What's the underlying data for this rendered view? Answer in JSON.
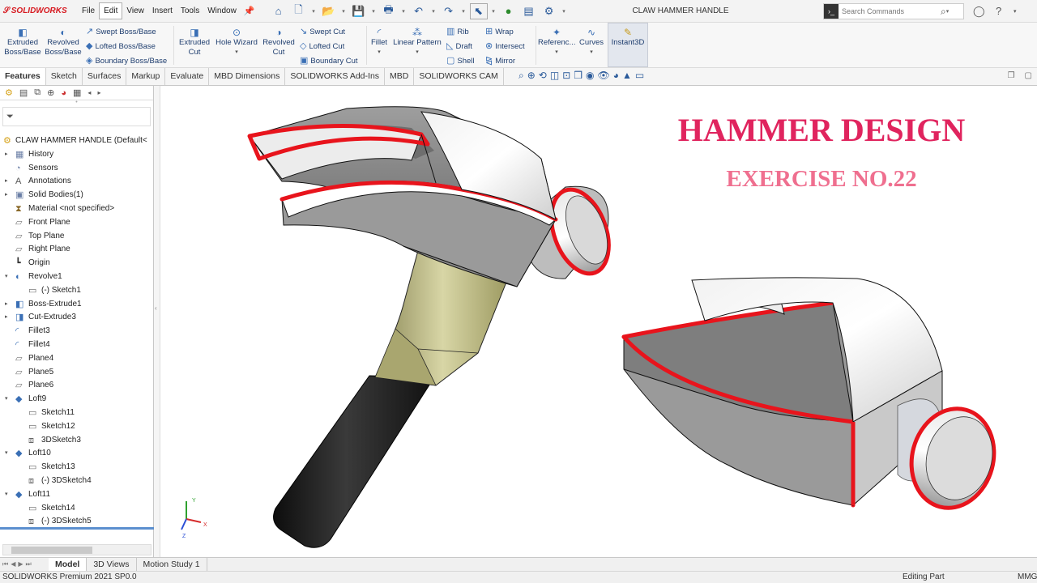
{
  "app": {
    "brand": "SOLIDWORKS",
    "document_title": "CLAW HAMMER HANDLE"
  },
  "menu": {
    "items": [
      "File",
      "Edit",
      "View",
      "Insert",
      "Tools",
      "Window"
    ],
    "active_item": "Edit"
  },
  "search": {
    "placeholder": "Search Commands"
  },
  "ribbon": {
    "extruded_boss": "Extruded Boss/Base",
    "revolved_boss": "Revolved Boss/Base",
    "swept_boss": "Swept Boss/Base",
    "lofted_boss": "Lofted Boss/Base",
    "boundary_boss": "Boundary Boss/Base",
    "extruded_cut": "Extruded Cut",
    "hole_wizard": "Hole Wizard",
    "revolved_cut": "Revolved Cut",
    "swept_cut": "Swept Cut",
    "lofted_cut": "Lofted Cut",
    "boundary_cut": "Boundary Cut",
    "fillet": "Fillet",
    "linear_pattern": "Linear Pattern",
    "rib": "Rib",
    "draft": "Draft",
    "shell": "Shell",
    "wrap": "Wrap",
    "intersect": "Intersect",
    "mirror": "Mirror",
    "reference": "Referenc...",
    "curves": "Curves",
    "instant3d": "Instant3D"
  },
  "command_tabs": [
    "Features",
    "Sketch",
    "Surfaces",
    "Markup",
    "Evaluate",
    "MBD Dimensions",
    "SOLIDWORKS Add-Ins",
    "MBD",
    "SOLIDWORKS CAM"
  ],
  "feature_tree": {
    "root": "CLAW HAMMER HANDLE  (Default<",
    "nodes": [
      {
        "label": "History",
        "level": 0,
        "expandable": true,
        "icon": "folder-icon"
      },
      {
        "label": "Sensors",
        "level": 0,
        "expandable": false,
        "icon": "sensor-icon"
      },
      {
        "label": "Annotations",
        "level": 0,
        "expandable": true,
        "icon": "annotation-icon"
      },
      {
        "label": "Solid Bodies(1)",
        "level": 0,
        "expandable": true,
        "icon": "solid-body-icon"
      },
      {
        "label": "Material <not specified>",
        "level": 0,
        "expandable": false,
        "icon": "material-icon"
      },
      {
        "label": "Front Plane",
        "level": 0,
        "expandable": false,
        "icon": "plane-icon"
      },
      {
        "label": "Top Plane",
        "level": 0,
        "expandable": false,
        "icon": "plane-icon"
      },
      {
        "label": "Right Plane",
        "level": 0,
        "expandable": false,
        "icon": "plane-icon"
      },
      {
        "label": "Origin",
        "level": 0,
        "expandable": false,
        "icon": "origin-icon"
      },
      {
        "label": "Revolve1",
        "level": 0,
        "expandable": true,
        "expanded": true,
        "icon": "revolve-icon"
      },
      {
        "label": "(-) Sketch1",
        "level": 1,
        "expandable": false,
        "icon": "sketch-icon"
      },
      {
        "label": "Boss-Extrude1",
        "level": 0,
        "expandable": true,
        "icon": "extrude-icon"
      },
      {
        "label": "Cut-Extrude3",
        "level": 0,
        "expandable": true,
        "icon": "cut-extrude-icon"
      },
      {
        "label": "Fillet3",
        "level": 0,
        "expandable": false,
        "icon": "fillet-icon"
      },
      {
        "label": "Fillet4",
        "level": 0,
        "expandable": false,
        "icon": "fillet-icon"
      },
      {
        "label": "Plane4",
        "level": 0,
        "expandable": false,
        "icon": "plane-icon"
      },
      {
        "label": "Plane5",
        "level": 0,
        "expandable": false,
        "icon": "plane-icon"
      },
      {
        "label": "Plane6",
        "level": 0,
        "expandable": false,
        "icon": "plane-icon"
      },
      {
        "label": "Loft9",
        "level": 0,
        "expandable": true,
        "expanded": true,
        "icon": "loft-icon"
      },
      {
        "label": "Sketch11",
        "level": 1,
        "expandable": false,
        "icon": "sketch-icon"
      },
      {
        "label": "Sketch12",
        "level": 1,
        "expandable": false,
        "icon": "sketch-icon"
      },
      {
        "label": "3DSketch3",
        "level": 1,
        "expandable": false,
        "icon": "3dsketch-icon"
      },
      {
        "label": "Loft10",
        "level": 0,
        "expandable": true,
        "expanded": true,
        "icon": "loft-icon"
      },
      {
        "label": "Sketch13",
        "level": 1,
        "expandable": false,
        "icon": "sketch-icon"
      },
      {
        "label": "(-) 3DSketch4",
        "level": 1,
        "expandable": false,
        "icon": "3dsketch-icon"
      },
      {
        "label": "Loft11",
        "level": 0,
        "expandable": true,
        "expanded": true,
        "icon": "loft-icon"
      },
      {
        "label": "Sketch14",
        "level": 1,
        "expandable": false,
        "icon": "sketch-icon"
      },
      {
        "label": "(-) 3DSketch5",
        "level": 1,
        "expandable": false,
        "icon": "3dsketch-icon"
      }
    ]
  },
  "viewport": {
    "title": "HAMMER DESIGN",
    "subtitle": "EXERCISE NO.22",
    "title_color": "#e0245e",
    "subtitle_color": "#ef6f8f",
    "triad": {
      "x": "X",
      "y": "Y",
      "z": "Z"
    }
  },
  "bottom_tabs": [
    "Model",
    "3D Views",
    "Motion Study 1"
  ],
  "bottom_active": "Model",
  "status": {
    "version": "SOLIDWORKS Premium 2021 SP0.0",
    "mode": "Editing Part",
    "units": "MMG"
  },
  "colors": {
    "accent_red": "#d71920",
    "edge_red": "#e8141c",
    "handle_black": "#1c1c1c",
    "handle_grip": "#c9c79a"
  }
}
